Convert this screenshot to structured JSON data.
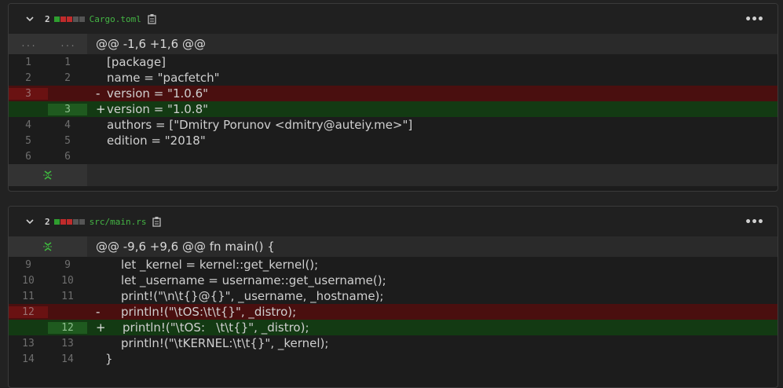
{
  "files": [
    {
      "count": "2",
      "name": "Cargo.toml",
      "hunk": {
        "old": "...",
        "new": "...",
        "header": "@@ -1,6 +1,6 @@"
      },
      "lines": [
        {
          "type": "plain",
          "old": "1",
          "new": "1",
          "code": "[package]"
        },
        {
          "type": "plain",
          "old": "2",
          "new": "2",
          "code": "name = \"pacfetch\""
        },
        {
          "type": "del",
          "old": "3",
          "new": "",
          "mark": "-",
          "code": "version = \"1.0.6\""
        },
        {
          "type": "add",
          "old": "",
          "new": "3",
          "mark": "+",
          "code": "version = \"1.0.8\""
        },
        {
          "type": "plain",
          "old": "4",
          "new": "4",
          "code": "authors = [\"Dmitry Porunov <dmitry@auteiy.me>\"]"
        },
        {
          "type": "plain",
          "old": "5",
          "new": "5",
          "code": "edition = \"2018\""
        },
        {
          "type": "plain",
          "old": "6",
          "new": "6",
          "code": ""
        }
      ]
    },
    {
      "count": "2",
      "name": "src/main.rs",
      "hunk": {
        "header": "@@ -9,6 +9,6 @@ fn main() {"
      },
      "lines": [
        {
          "type": "plain",
          "old": "9",
          "new": "9",
          "code": "let _kernel = kernel::get_kernel();"
        },
        {
          "type": "plain",
          "old": "10",
          "new": "10",
          "code": "let _username = username::get_username();"
        },
        {
          "type": "plain",
          "old": "11",
          "new": "11",
          "code": "print!(\"\\n\\t{}@{}\", _username, _hostname);"
        },
        {
          "type": "del",
          "old": "12",
          "new": "",
          "mark": "-",
          "code": "println!(\"\\tOS:\\t\\t{}\", _distro);"
        },
        {
          "type": "add",
          "old": "",
          "new": "12",
          "mark": "+",
          "code": "println!(\"\\tOS:   \\t\\t{}\", _distro);"
        },
        {
          "type": "plain",
          "old": "13",
          "new": "13",
          "code": "println!(\"\\tKERNEL:\\t\\t{}\", _kernel);"
        },
        {
          "type": "plain",
          "old": "14",
          "new": "14",
          "code": "}"
        }
      ]
    }
  ],
  "colors": {
    "added": "#2f9e2f",
    "removed": "#c02b2b",
    "neutral": "#555555",
    "filename": "#44b544"
  },
  "icons": [
    "chevron-down-icon",
    "copy-icon",
    "kebab-menu-icon",
    "expand-icon"
  ]
}
